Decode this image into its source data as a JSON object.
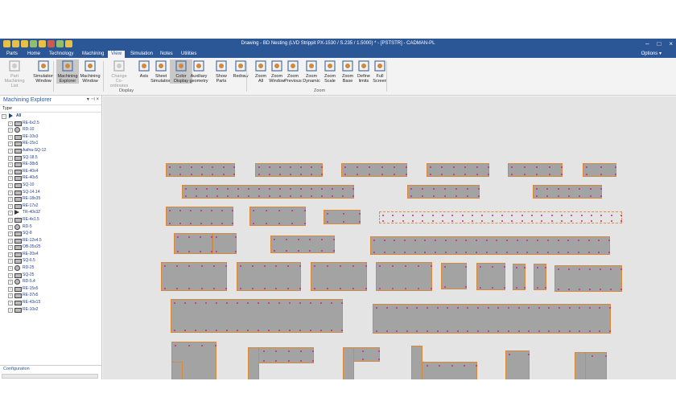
{
  "app": {
    "title": "Drawing - BD Nesting  (LVD Strippit PX-1530 / S.235 / 1.5000) * - [PSTSTR] - CADMAN-PL"
  },
  "tabs": [
    {
      "label": "Parts"
    },
    {
      "label": "Home"
    },
    {
      "label": "Technology"
    },
    {
      "label": "Machining"
    },
    {
      "label": "View",
      "active": true
    },
    {
      "label": "Simulation"
    },
    {
      "label": "Notes"
    },
    {
      "label": "Utilities"
    }
  ],
  "options_label": "Options",
  "ribbon": {
    "buttons": [
      {
        "label": "Part Machining\nList",
        "icon": "list-icon",
        "disabled": true
      },
      {
        "label": "Simulation\nWindow",
        "icon": "simulation-window-icon"
      },
      {
        "label": "Machining\nExplorer",
        "icon": "machining-explorer-icon",
        "selected": true
      },
      {
        "label": "Machining\nWindow",
        "icon": "machining-window-icon"
      },
      {
        "label": "Change\nCo-ordinates",
        "icon": "coordinates-icon",
        "disabled": true
      },
      {
        "label": "Axis",
        "icon": "axis-icon"
      },
      {
        "label": "Sheet\nSimulation",
        "icon": "sheet-simulation-icon"
      },
      {
        "label": "Color\nDisplay",
        "icon": "color-display-icon",
        "selected": true
      },
      {
        "label": "Auxiliary\ngeometry",
        "icon": "auxiliary-geometry-icon"
      },
      {
        "label": "Show\nParts",
        "icon": "show-parts-icon"
      },
      {
        "label": "Redraw",
        "icon": "redraw-icon"
      },
      {
        "label": "Zoom\nAll",
        "icon": "zoom-all-icon"
      },
      {
        "label": "Zoom\nWindow",
        "icon": "zoom-window-icon"
      },
      {
        "label": "Zoom\nPrevious",
        "icon": "zoom-previous-icon"
      },
      {
        "label": "Zoom\nDynamic",
        "icon": "zoom-dynamic-icon"
      },
      {
        "label": "Zoom\nScale",
        "icon": "zoom-scale-icon"
      },
      {
        "label": "Zoom\nBase",
        "icon": "zoom-base-icon"
      },
      {
        "label": "Define\nlimits",
        "icon": "define-limits-icon"
      },
      {
        "label": "Full\nScreen",
        "icon": "full-screen-icon"
      }
    ],
    "groups": [
      {
        "label": "Display"
      },
      {
        "label": "Zoom"
      }
    ]
  },
  "sidebar": {
    "title": "Machining Explorer",
    "column_header": "Type",
    "root": "All",
    "items": [
      {
        "label": "RE-6x2.5",
        "icon": "rect"
      },
      {
        "label": "RD-10",
        "icon": "circle"
      },
      {
        "label": "RE-10x3",
        "icon": "rect"
      },
      {
        "label": "RE-15x1",
        "icon": "rect"
      },
      {
        "label": "Aafna-SQ-12",
        "icon": "rect"
      },
      {
        "label": "SQ-18.5",
        "icon": "rect"
      },
      {
        "label": "RE-38x5",
        "icon": "rect"
      },
      {
        "label": "RE-40x4",
        "icon": "rect"
      },
      {
        "label": "RE-40x5",
        "icon": "rect"
      },
      {
        "label": "SQ-10",
        "icon": "rect"
      },
      {
        "label": "SQ-14.14",
        "icon": "rect"
      },
      {
        "label": "RE-18x35",
        "icon": "rect"
      },
      {
        "label": "RE-17x2",
        "icon": "rect"
      },
      {
        "label": "TR-40x32",
        "icon": "triangle"
      },
      {
        "label": "RE-4x1.5",
        "icon": "rect"
      },
      {
        "label": "RD-5",
        "icon": "circle"
      },
      {
        "label": "SQ-8",
        "icon": "rect"
      },
      {
        "label": "RE-12x4.5",
        "icon": "rect"
      },
      {
        "label": "OB-35x25",
        "icon": "rect"
      },
      {
        "label": "RE-20x4",
        "icon": "rect"
      },
      {
        "label": "SQ-6.5",
        "icon": "rect"
      },
      {
        "label": "RD-25",
        "icon": "circle"
      },
      {
        "label": "SQ-25",
        "icon": "rect"
      },
      {
        "label": "RD-5.4",
        "icon": "circle"
      },
      {
        "label": "RE-15x5",
        "icon": "rect"
      },
      {
        "label": "RE-37x5",
        "icon": "rect"
      },
      {
        "label": "RE-43x15",
        "icon": "rect"
      },
      {
        "label": "RE-10x2",
        "icon": "rect"
      }
    ],
    "footer": "Configuration"
  },
  "canvas": {
    "part_count": 36
  },
  "colors": {
    "title_bar": "#2b5797",
    "part_fill": "#a3a3a3",
    "part_outline": "#d9883a",
    "tool_hit": "#d0238a",
    "canvas_bg": "#e4e4e4"
  }
}
